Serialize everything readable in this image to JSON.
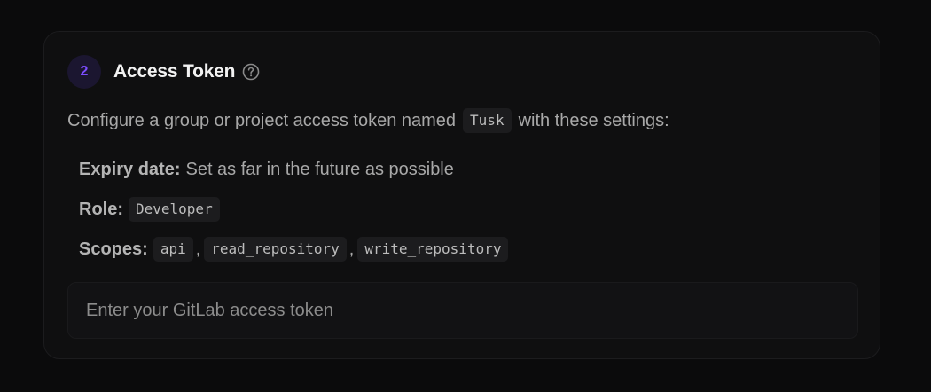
{
  "step": {
    "number": "2",
    "title": "Access Token",
    "help_icon": "question-circle-icon"
  },
  "description": {
    "before": "Configure a group or project access token named",
    "token_name": "Tusk",
    "after": "with these settings:"
  },
  "settings": {
    "expiry": {
      "label": "Expiry date:",
      "value": "Set as far in the future as possible"
    },
    "role": {
      "label": "Role:",
      "value": "Developer"
    },
    "scopes": {
      "label": "Scopes:",
      "values": [
        "api",
        "read_repository",
        "write_repository"
      ],
      "separator": ","
    }
  },
  "token_input": {
    "value": "",
    "placeholder": "Enter your GitLab access token"
  },
  "colors": {
    "accent": "#7c4dff",
    "background": "#0b0b0c",
    "card": "#0f0f10"
  }
}
